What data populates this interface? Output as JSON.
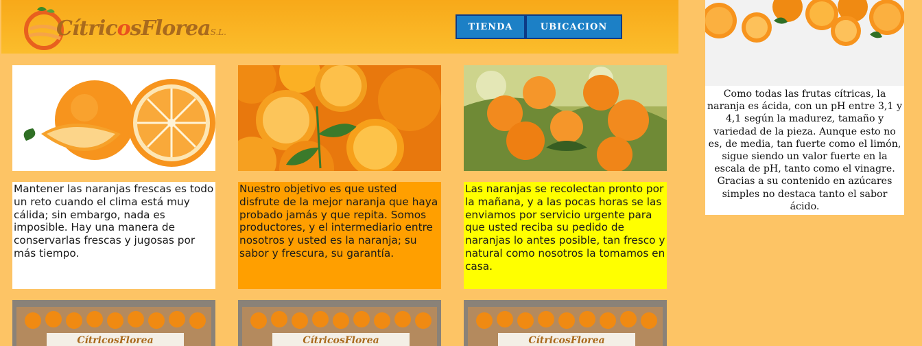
{
  "brand": {
    "name_part1": "Cítric",
    "name_o": "o",
    "name_part2": "s",
    "name_part3": "Florea",
    "suffix": "S.L."
  },
  "nav": {
    "tienda": "TIENDA",
    "ubicacion": "UBICACION"
  },
  "cards": [
    {
      "text": "Mantener las naranjas frescas es todo un reto cuando el clima está muy cálida; sin embargo, nada es imposible. Hay una manera de conservarlas frescas y jugosas por más tiempo."
    },
    {
      "text": "Nuestro objetivo es que usted disfrute de la mejor naranja que haya probado jamás y que repita. Somos productores, y el intermediario entre nosotros y usted es la naranja; su sabor y frescura, su garantía."
    },
    {
      "text": "Las naranjas se recolectan pronto por la mañana, y a las pocas horas se las enviamos por servicio urgente para que usted reciba su pedido de naranjas lo antes posible, tan fresco y natural como nosotros la tomamos en casa."
    }
  ],
  "side": {
    "text": "Como todas las frutas cítricas, la naranja es ácida, con un pH entre 3,1 y 4,1 según la madurez, tamaño y variedad de la pieza. Aunque esto no es, de media, tan fuerte como el limón, sigue siendo un valor fuerte en la escala de pH, tanto como el vinagre. Gracias a su contenido en azúcares simples no destaca tanto el sabor ácido."
  },
  "colors": {
    "background": "#fdc465",
    "header": "#f8a919",
    "button": "#1c80c6",
    "card_white": "#ffffff",
    "card_orange": "#ff9f00",
    "card_yellow": "#ffff00"
  }
}
